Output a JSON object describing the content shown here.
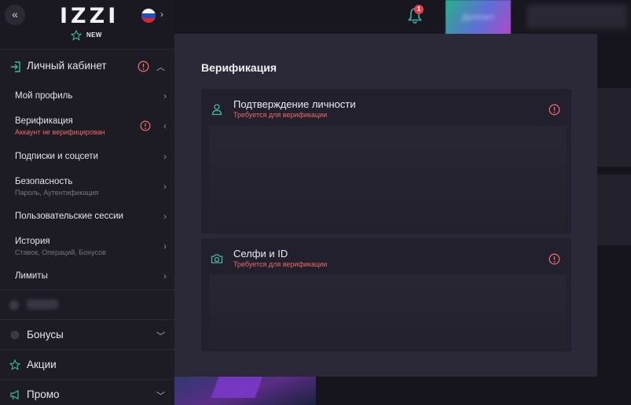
{
  "sidebar": {
    "collapse_icon": "«",
    "logo": "IZZI",
    "lang_arrow": "›",
    "new_badge": "NEW",
    "account": {
      "label": "Личный кабинет",
      "items": [
        {
          "title": "Мой профиль",
          "subtitle": ""
        },
        {
          "title": "Верификация",
          "subtitle": "Аккаунт не верифицирован"
        },
        {
          "title": "Подписки и соцсети",
          "subtitle": ""
        },
        {
          "title": "Безопасность",
          "subtitle": "Пароль, Аутентификация"
        },
        {
          "title": "Пользовательские сессии",
          "subtitle": ""
        },
        {
          "title": "История",
          "subtitle": "Ставок, Операций, Бонусов"
        },
        {
          "title": "Лимиты",
          "subtitle": ""
        }
      ]
    },
    "nav": [
      {
        "label": "Бонусы"
      },
      {
        "label": "Акции"
      },
      {
        "label": "Промо"
      }
    ]
  },
  "header": {
    "notification_count": "1"
  },
  "modal": {
    "title": "Верификация",
    "cards": [
      {
        "title": "Подтверждение личности",
        "subtitle": "Требуется для верификации",
        "icon": "user-icon"
      },
      {
        "title": "Селфи и ID",
        "subtitle": "Требуется для верификации",
        "icon": "camera-icon"
      }
    ]
  },
  "colors": {
    "accent_teal": "#3fb7a3",
    "warning_red": "#e96a6a",
    "sidebar_bg": "#1d1b24",
    "modal_bg": "#2b2938"
  }
}
